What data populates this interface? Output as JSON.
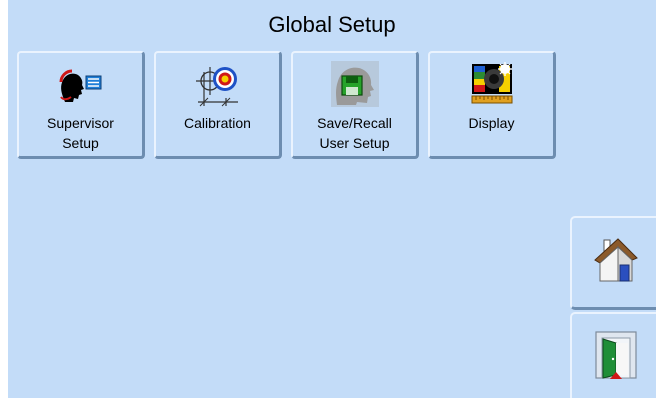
{
  "header": {
    "title": "Global Setup"
  },
  "tiles": [
    {
      "id": "supervisor",
      "icon": "supervisor-head-icon",
      "line1": "Supervisor",
      "line2": "Setup"
    },
    {
      "id": "calibration",
      "icon": "calibration-target-icon",
      "line1": "Calibration",
      "line2": ""
    },
    {
      "id": "save-recall",
      "icon": "save-recall-head-icon",
      "line1": "Save/Recall",
      "line2": "User Setup"
    },
    {
      "id": "display",
      "icon": "display-screen-icon",
      "line1": "Display",
      "line2": ""
    }
  ],
  "side": {
    "home_icon": "home-icon",
    "exit_icon": "exit-door-icon"
  },
  "colors": {
    "background": "#c3dcf8",
    "button_shadow": "#6d8db0",
    "button_highlight": "#eaf3fe"
  }
}
